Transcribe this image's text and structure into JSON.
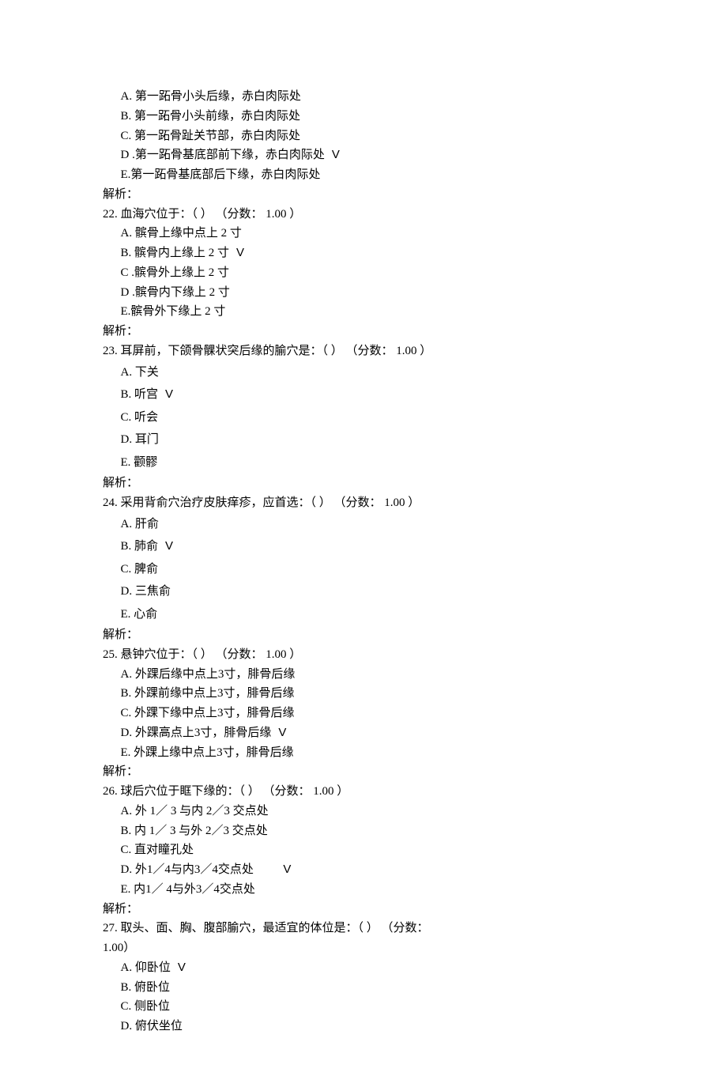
{
  "analysis_label": "解析：",
  "score_open": "（分数：",
  "score_close": "）",
  "paren_open": "（",
  "paren_close": "）",
  "check_mark": "V",
  "questions": [
    {
      "num": "",
      "stem": "",
      "score": "",
      "options": [
        {
          "label": "A.",
          "text": "第一跖骨小头后缘，赤白肉际处",
          "correct": false
        },
        {
          "label": "B.",
          "text": "第一跖骨小头前缘，赤白肉际处",
          "correct": false
        },
        {
          "label": "C.",
          "text": "第一跖骨趾关节部，赤白肉际处",
          "correct": false
        },
        {
          "label": "D .",
          "text": "第一跖骨基底部前下缘，赤白肉际处",
          "correct": true,
          "tight": true
        },
        {
          "label": "E.",
          "text": "第一跖骨基底部后下缘，赤白肉际处",
          "correct": false,
          "tight": true
        }
      ]
    },
    {
      "num": "22.",
      "stem": "血海穴位于：",
      "score": "1.00",
      "options": [
        {
          "label": "A.",
          "text": "髌骨上缘中点上 2 寸",
          "correct": false
        },
        {
          "label": "B.",
          "text": "髌骨内上缘上 2 寸",
          "correct": true
        },
        {
          "label": "C .",
          "text": "髌骨外上缘上 2 寸",
          "correct": false,
          "tight": true
        },
        {
          "label": "D .",
          "text": "髌骨内下缘上 2 寸",
          "correct": false,
          "tight": true
        },
        {
          "label": "E.",
          "text": "髌骨外下缘上 2 寸",
          "correct": false,
          "tight": true
        }
      ]
    },
    {
      "num": "23.",
      "stem": "耳屏前，下颌骨髁状突后缘的腧穴是：",
      "score": "1.00",
      "options": [
        {
          "label": "A.",
          "text": "下关",
          "correct": false
        },
        {
          "label": "B.",
          "text": "听宫",
          "correct": true
        },
        {
          "label": "C.",
          "text": "听会",
          "correct": false
        },
        {
          "label": "D.",
          "text": "耳门",
          "correct": false
        },
        {
          "label": "E.",
          "text": "颧髎",
          "correct": false
        }
      ],
      "loose": true
    },
    {
      "num": "24.",
      "stem": "采用背俞穴治疗皮肤痒疹，应首选：",
      "score": "1.00",
      "options": [
        {
          "label": "A.",
          "text": "肝俞",
          "correct": false
        },
        {
          "label": "B.",
          "text": "肺俞",
          "correct": true
        },
        {
          "label": "C.",
          "text": "脾俞",
          "correct": false
        },
        {
          "label": "D.",
          "text": "三焦俞",
          "correct": false
        },
        {
          "label": "E.",
          "text": "心俞",
          "correct": false
        }
      ],
      "loose": true
    },
    {
      "num": "25.",
      "stem": "悬钟穴位于：",
      "score": "1.00",
      "options": [
        {
          "label": "A.",
          "text": "外踝后缘中点上3寸，腓骨后缘",
          "correct": false
        },
        {
          "label": "B.",
          "text": "外踝前缘中点上3寸，腓骨后缘",
          "correct": false
        },
        {
          "label": "C.",
          "text": "外踝下缘中点上3寸，腓骨后缘",
          "correct": false
        },
        {
          "label": "D.",
          "text": "外踝高点上3寸，腓骨后缘",
          "correct": true
        },
        {
          "label": "E.",
          "text": "外踝上缘中点上3寸，腓骨后缘",
          "correct": false
        }
      ]
    },
    {
      "num": "26.",
      "stem": "球后穴位于眶下缘的：",
      "score": "1.00",
      "options": [
        {
          "label": "A.",
          "text": "外 1／ 3 与内 2／3 交点处",
          "correct": false
        },
        {
          "label": "B.",
          "text": "内 1／ 3 与外 2／3 交点处",
          "correct": false
        },
        {
          "label": "C.",
          "text": "直对瞳孔处",
          "correct": false
        },
        {
          "label": "D.",
          "text": "外1／4与内3／4交点处",
          "correct": true,
          "wide_check": true
        },
        {
          "label": "E.",
          "text": "内1／ 4与外3／4交点处",
          "correct": false
        }
      ]
    },
    {
      "num": "27.",
      "stem_full": "取头、面、胸、腹部腧穴，最适宜的体位是：（  ） （分数：\n1.00）",
      "options": [
        {
          "label": "A.",
          "text": "仰卧位",
          "correct": true
        },
        {
          "label": "B.",
          "text": "俯卧位",
          "correct": false
        },
        {
          "label": "C.",
          "text": "侧卧位",
          "correct": false
        },
        {
          "label": "D.",
          "text": "俯伏坐位",
          "correct": false
        }
      ],
      "no_analysis": true
    }
  ]
}
